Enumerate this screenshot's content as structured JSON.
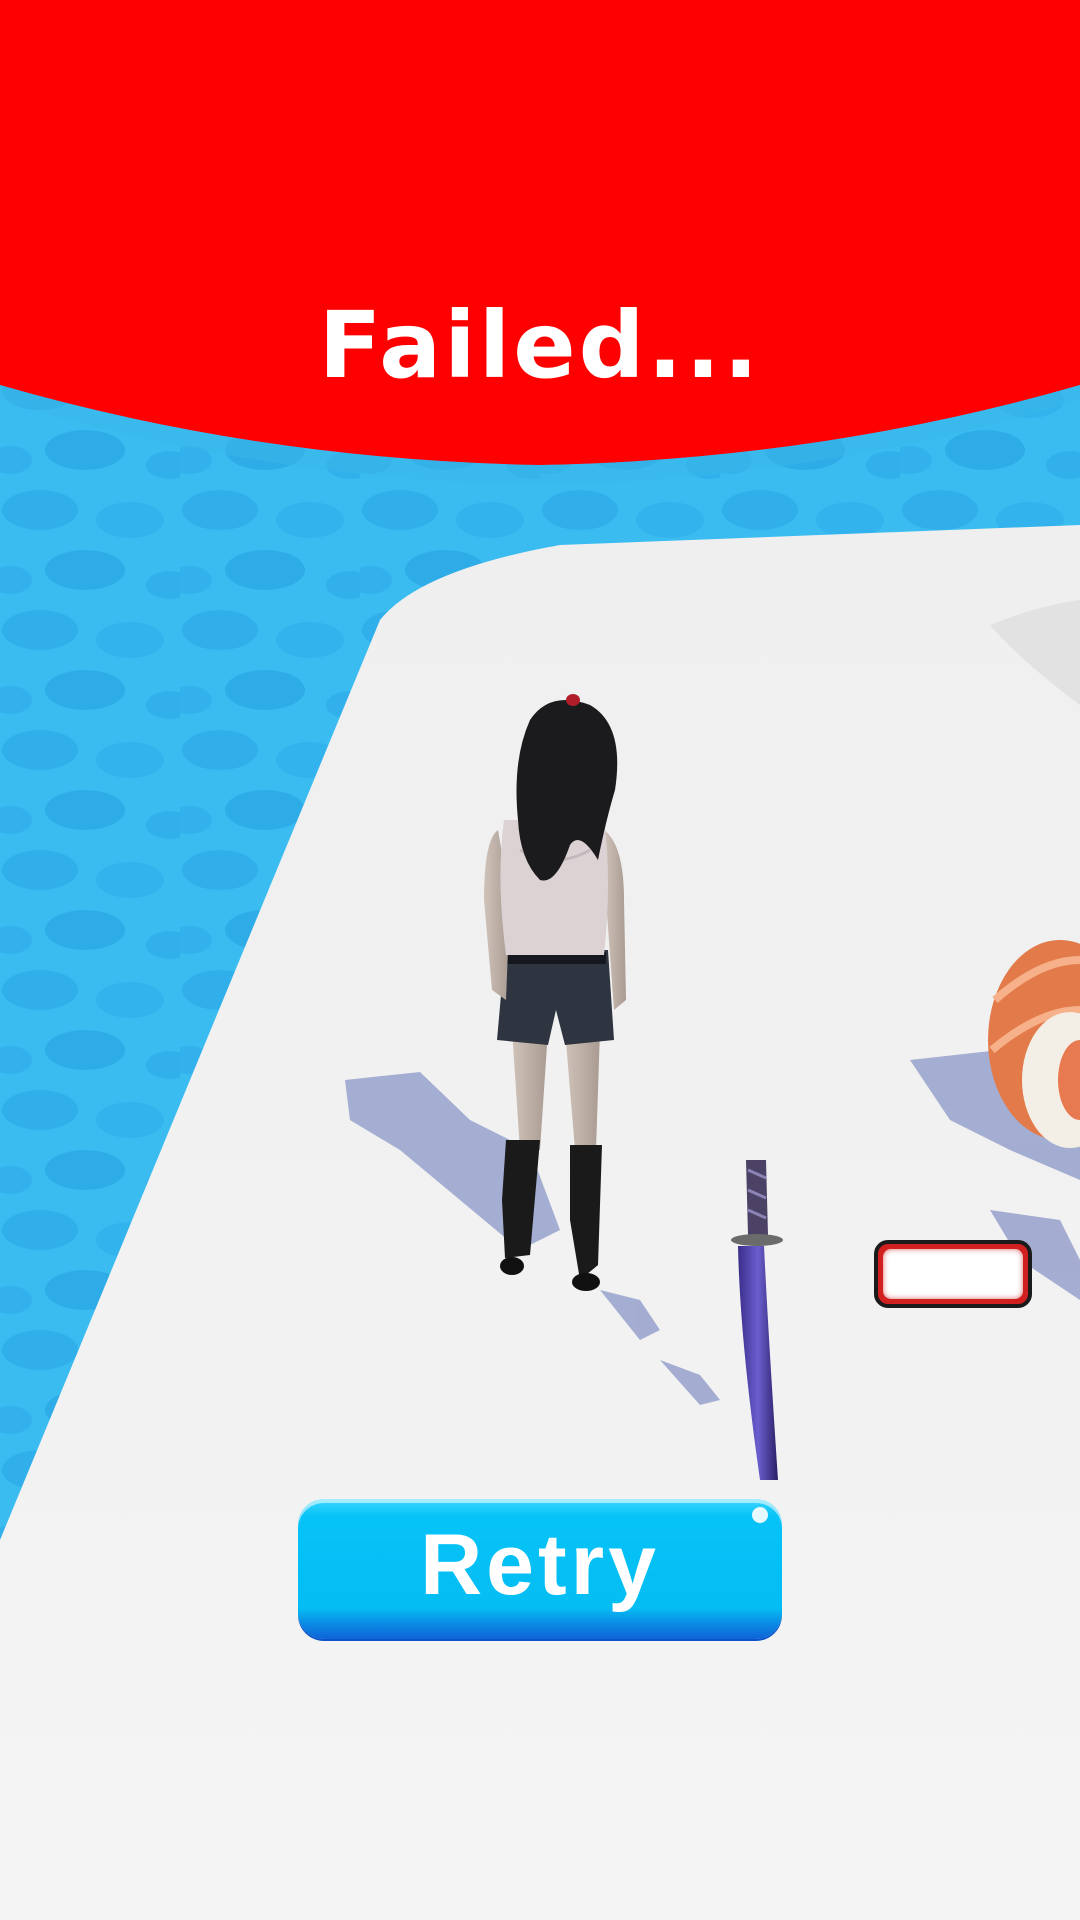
{
  "status": {
    "title": "Failed..."
  },
  "actions": {
    "retry_label": "Retry"
  },
  "enemy": {
    "health_fraction": 1.0
  },
  "icons": {
    "player": "girl-character-icon",
    "weapon": "katana-icon",
    "enemy": "sushi-roll-icon"
  },
  "colors": {
    "banner": "#ff0000",
    "water": "#2fb8ee",
    "floor": "#f3f3f3",
    "retry": "#04bdf3",
    "health_frame": "#d02020"
  }
}
